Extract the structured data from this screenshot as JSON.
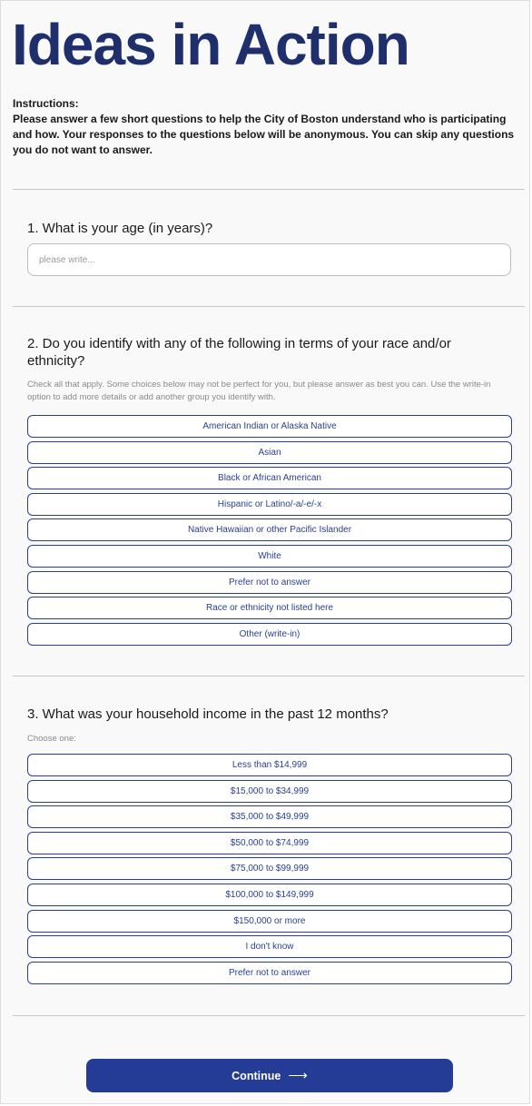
{
  "page": {
    "title": "Ideas in Action",
    "instructions_heading": "Instructions:",
    "instructions_body": "Please answer a few short questions to help the City of Boston understand who is participating and how. Your responses to the questions below will be anonymous. You can skip any questions you do not want to answer."
  },
  "questions": {
    "q1": {
      "label": "1. What is your age (in years)?",
      "placeholder": "please write...",
      "value": ""
    },
    "q2": {
      "label": "2. Do you identify with any of the following in terms of your race and/or ethnicity?",
      "help": "Check all that apply. Some choices below may not be perfect for you, but please answer as best you can. Use the write-in option to add more details or add another group you identify with.",
      "options": [
        "American Indian or Alaska Native",
        "Asian",
        "Black or African American",
        "Hispanic or Latino/-a/-e/-x",
        "Native Hawaiian or other Pacific Islander",
        "White",
        "Prefer not to answer",
        "Race or ethnicity not listed here",
        "Other (write-in)"
      ]
    },
    "q3": {
      "label": "3. What was your household income in the past 12 months?",
      "help": "Choose one:",
      "options": [
        "Less than $14,999",
        "$15,000 to $34,999",
        "$35,000 to $49,999",
        "$50,000 to $74,999",
        "$75,000 to $99,999",
        "$100,000 to $149,999",
        "$150,000 or more",
        "I don't know",
        "Prefer not to answer"
      ]
    }
  },
  "footer": {
    "continue_label": "Continue",
    "continue_icon": "arrow-right-icon",
    "accent_color": "#243c96",
    "title_color": "#1f2f6b"
  }
}
